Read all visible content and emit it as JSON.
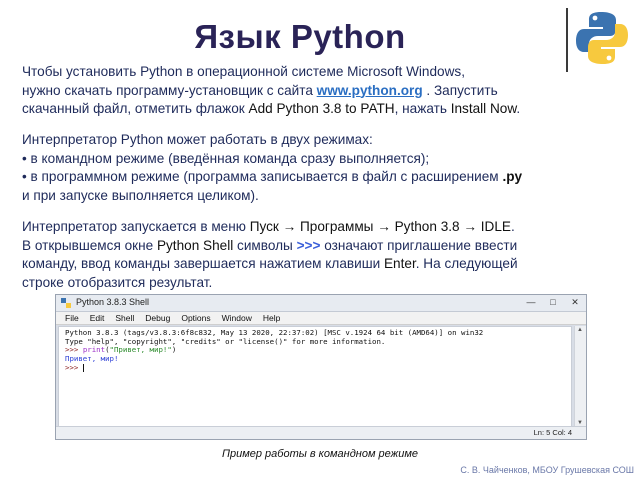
{
  "title": "Язык Python",
  "para1": {
    "line1": "Чтобы установить Python в операционной системе Microsoft Windows,",
    "line2_a": "нужно скачать программу-установщик с сайта ",
    "link": "www.python.org",
    "line2_b": " . Запустить",
    "line3_a": "скачанный файл, отметить флажок ",
    "flag": "Add Python 3.8 to PATH",
    "line3_b": ", нажать ",
    "install": "Install Now",
    "line3_c": "."
  },
  "para2": {
    "line1": "Интерпретатор Python может работать в двух режимах:",
    "line2": "• в командном режиме (введённая команда сразу выполняется);",
    "line3_a": "• в программном режиме (программа записывается в файл с расширением ",
    "ext": ".py",
    "line4": "и при запуске выполняется целиком)."
  },
  "para3": {
    "line1_a": "Интерпретатор запускается в меню ",
    "menu_path": "Пуск → Программы → Python 3.8 → IDLE",
    "line1_b": ".",
    "line2_a": "В открывшемся окне ",
    "shell_name": "Python Shell",
    "line2_b": " символы ",
    "prompt": ">>>",
    "line2_c": " означают приглашение ввести",
    "line3_a": "команду, ввод команды завершается нажатием клавиши ",
    "enter": "Enter",
    "line3_b": ". На следующей",
    "line4": "строке отобразится результат."
  },
  "shell": {
    "window_title": "Python 3.8.3 Shell",
    "menu": [
      "File",
      "Edit",
      "Shell",
      "Debug",
      "Options",
      "Window",
      "Help"
    ],
    "line1": "Python 3.8.3 (tags/v3.8.3:6f8c832, May 13 2020, 22:37:02) [MSC v.1924 64 bit (AMD64)] on win32",
    "line2": "Type \"help\", \"copyright\", \"credits\" or \"license()\" for more information.",
    "prompt": ">>> ",
    "cmd_func": "print",
    "cmd_open": "(",
    "cmd_str": "\"Привет, мир!\"",
    "cmd_close": ")",
    "output": "Привет, мир!",
    "status": "Ln: 5  Col: 4"
  },
  "caption": "Пример работы в командном режиме",
  "footer": "С. В. Чайченков, МБОУ Грушевская СОШ"
}
